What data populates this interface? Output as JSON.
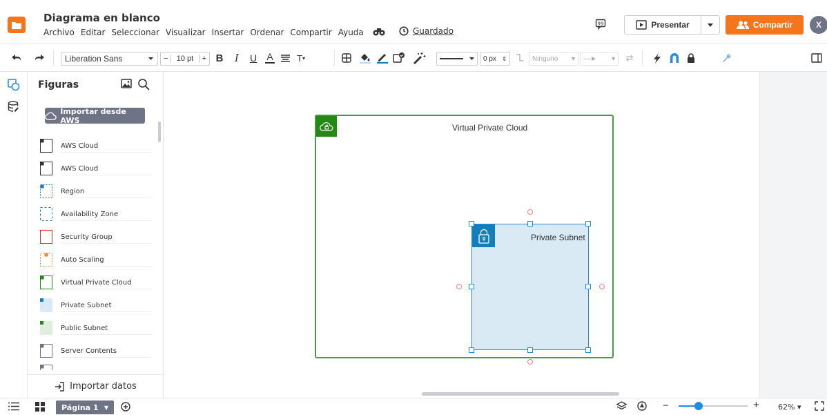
{
  "header": {
    "doc_title": "Diagrama en blanco",
    "menu": [
      "Archivo",
      "Editar",
      "Seleccionar",
      "Visualizar",
      "Insertar",
      "Ordenar",
      "Compartir",
      "Ayuda"
    ],
    "saved_label": "Guardado",
    "present_label": "Presentar",
    "share_label": "Compartir",
    "avatar_initial": "X"
  },
  "toolbar": {
    "font": "Liberation Sans",
    "font_size": "10 pt",
    "line_width": "0 px",
    "line_style_none": "Ninguno"
  },
  "panel": {
    "title": "Figuras",
    "import_aws": "Importar desde AWS",
    "import_data": "Importar datos",
    "shapes": [
      {
        "label": "AWS Cloud",
        "icon": "aws-cloud-dark"
      },
      {
        "label": "AWS Cloud",
        "icon": "aws-cloud-dark"
      },
      {
        "label": "Region",
        "icon": "region-dashed-blue"
      },
      {
        "label": "Availability Zone",
        "icon": "availability-zone-dashed"
      },
      {
        "label": "Security Group",
        "icon": "security-group-red"
      },
      {
        "label": "Auto Scaling",
        "icon": "auto-scaling-orange"
      },
      {
        "label": "Virtual Private Cloud",
        "icon": "vpc-green"
      },
      {
        "label": "Private Subnet",
        "icon": "private-subnet-blue"
      },
      {
        "label": "Public Subnet",
        "icon": "public-subnet-green"
      },
      {
        "label": "Server Contents",
        "icon": "server-contents-gray"
      }
    ]
  },
  "canvas": {
    "vpc_label": "Virtual Private Cloud",
    "subnet_label": "Private Subnet"
  },
  "bottom": {
    "page_label": "Página 1",
    "zoom": "62%"
  },
  "colors": {
    "accent_orange": "#f4751c",
    "vpc_green": "#248814",
    "subnet_blue": "#147eba",
    "subnet_fill": "#d9eaf4",
    "selection_blue": "#1f8ce6"
  }
}
